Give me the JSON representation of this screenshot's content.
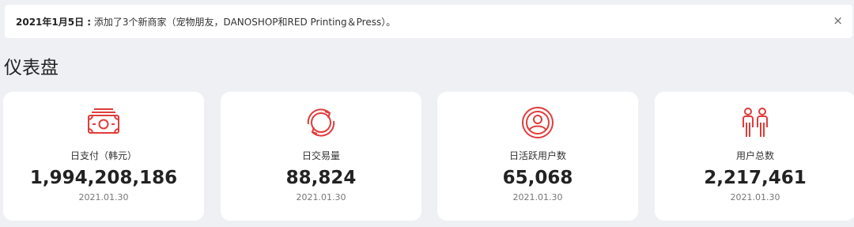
{
  "notice": {
    "date": "2021年1月5日 :",
    "message": "添加了3个新商家（宠物朋友，DANOSHOP和RED Printing＆Press）。",
    "close_label": "×"
  },
  "page": {
    "title": "仪表盘"
  },
  "colors": {
    "accent": "#e03c3c",
    "background": "#eef0f4",
    "card": "#ffffff"
  },
  "stats": [
    {
      "icon": "cash-icon",
      "label": "日支付（韩元）",
      "value": "1,994,208,186",
      "date": "2021.01.30"
    },
    {
      "icon": "refresh-cycle-icon",
      "label": "日交易量",
      "value": "88,824",
      "date": "2021.01.30"
    },
    {
      "icon": "user-broadcast-icon",
      "label": "日活跃用户数",
      "value": "65,068",
      "date": "2021.01.30"
    },
    {
      "icon": "users-pair-icon",
      "label": "用户总数",
      "value": "2,217,461",
      "date": "2021.01.30"
    }
  ]
}
